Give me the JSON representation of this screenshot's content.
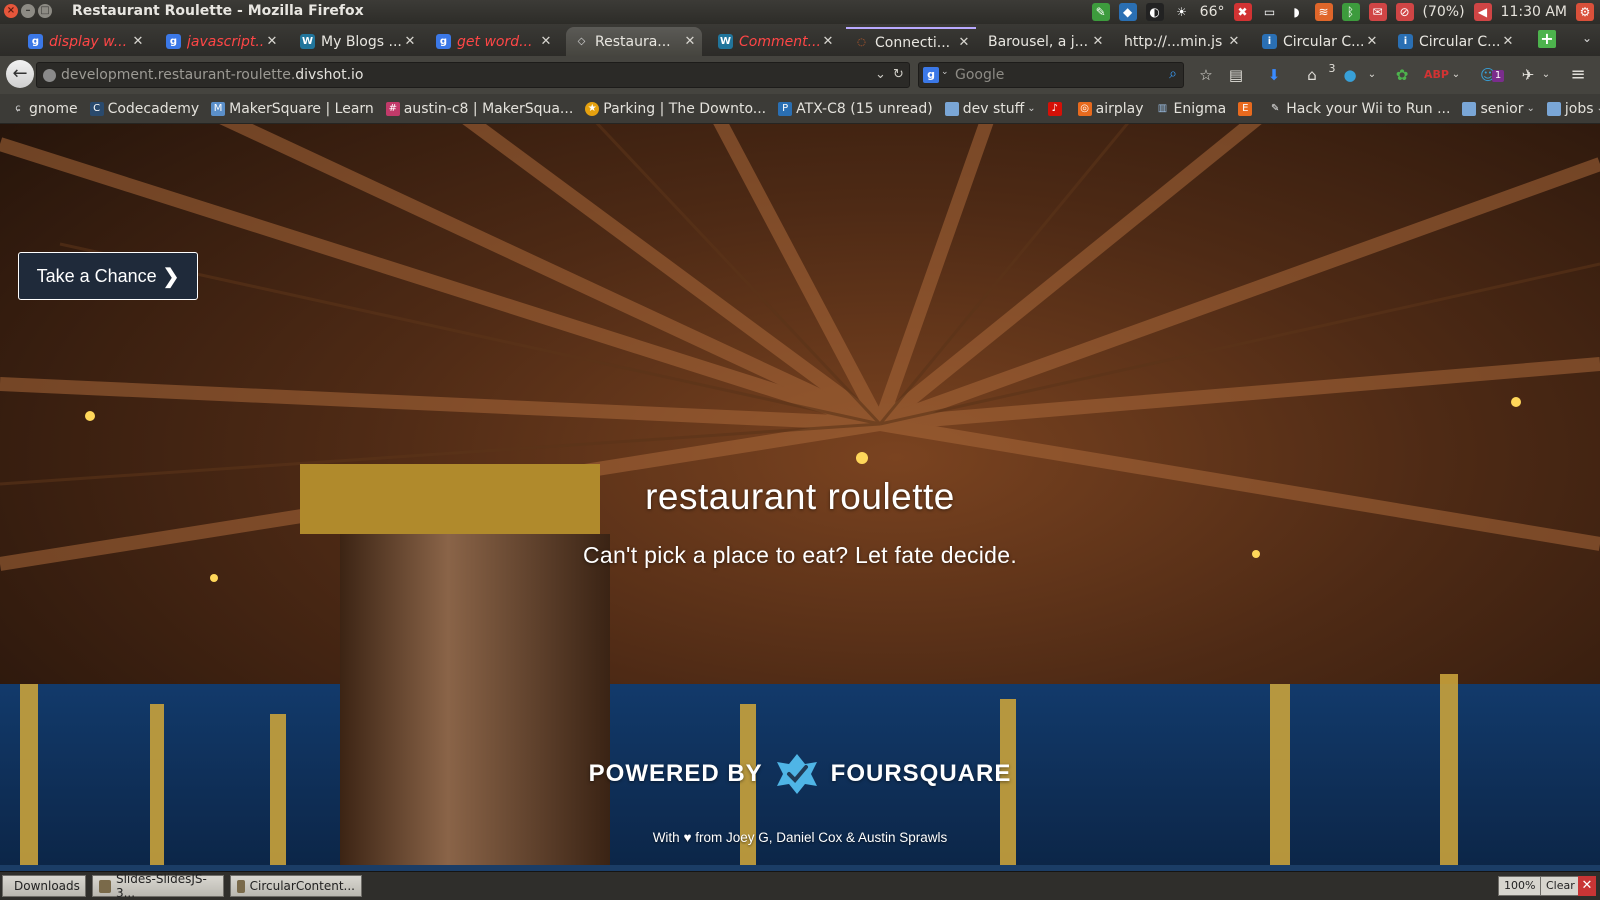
{
  "window": {
    "title": "Restaurant Roulette - Mozilla Firefox"
  },
  "system_tray": {
    "temperature": "66°",
    "battery": "(70%)",
    "time": "11:30 AM"
  },
  "tabs": [
    {
      "label": "display w...",
      "style": "red",
      "icon": "google-icon"
    },
    {
      "label": "javascript...",
      "style": "red",
      "icon": "google-icon"
    },
    {
      "label": "My Blogs ...",
      "style": "normal",
      "icon": "wordpress-icon"
    },
    {
      "label": "get word...",
      "style": "red",
      "icon": "google-icon"
    },
    {
      "label": "Restaura...",
      "style": "normal",
      "icon": "code-icon",
      "active": true
    },
    {
      "label": "Comment...",
      "style": "red",
      "icon": "wordpress-icon"
    },
    {
      "label": "Connecti...",
      "style": "normal",
      "icon": "loading-icon"
    },
    {
      "label": "Barousel, a j...",
      "style": "normal",
      "icon": "none"
    },
    {
      "label": "http://...min.js",
      "style": "normal",
      "icon": "none"
    },
    {
      "label": "Circular C...",
      "style": "normal",
      "icon": "site-icon"
    },
    {
      "label": "Circular C...",
      "style": "normal",
      "icon": "site-icon"
    }
  ],
  "navbar": {
    "url_prefix": "development.restaurant-roulette.",
    "url_domain": "divshot.io",
    "search_placeholder": "Google",
    "download_badge": "3",
    "notif_badge": "1"
  },
  "bookmarks": [
    {
      "label": "gnome",
      "icon": "gnome-icon"
    },
    {
      "label": "Codecademy",
      "icon": "codecademy-icon"
    },
    {
      "label": "MakerSquare | Learn",
      "icon": "makersquare-icon"
    },
    {
      "label": "austin-c8 | MakerSqua...",
      "icon": "hash-icon"
    },
    {
      "label": "Parking | The Downto...",
      "icon": "star-icon"
    },
    {
      "label": "ATX-C8 (15 unread)",
      "icon": "p-icon"
    },
    {
      "label": "dev stuff",
      "icon": "folder-icon",
      "dropdown": true
    },
    {
      "label": "",
      "icon": "lastfm-icon"
    },
    {
      "label": "airplay",
      "icon": "airplay-icon"
    },
    {
      "label": "Enigma",
      "icon": "enigma-icon"
    },
    {
      "label": "",
      "icon": "e-icon"
    },
    {
      "label": "Hack your Wii to Run ...",
      "icon": "wii-icon"
    },
    {
      "label": "senior",
      "icon": "folder-icon",
      "dropdown": true
    },
    {
      "label": "jobs",
      "icon": "folder-icon",
      "dropdown": true
    }
  ],
  "page": {
    "button_label": "Take a Chance",
    "title": "restaurant roulette",
    "subtitle": "Can't pick a place to eat? Let fate decide.",
    "powered_by": "POWERED BY",
    "provider": "FOURSQUARE",
    "credits": "With ♥ from Joey G, Daniel Cox & Austin Sprawls"
  },
  "taskbar": {
    "items": [
      "Downloads",
      "Slides-SlidesJS-3...",
      "CircularContent..."
    ],
    "zoom": "100%",
    "clear": "Clear"
  },
  "colors": {
    "button_bg": "#1f2a3a",
    "foursquare_blue": "#4fb5e6",
    "strip_blue": "#1b3d66"
  }
}
